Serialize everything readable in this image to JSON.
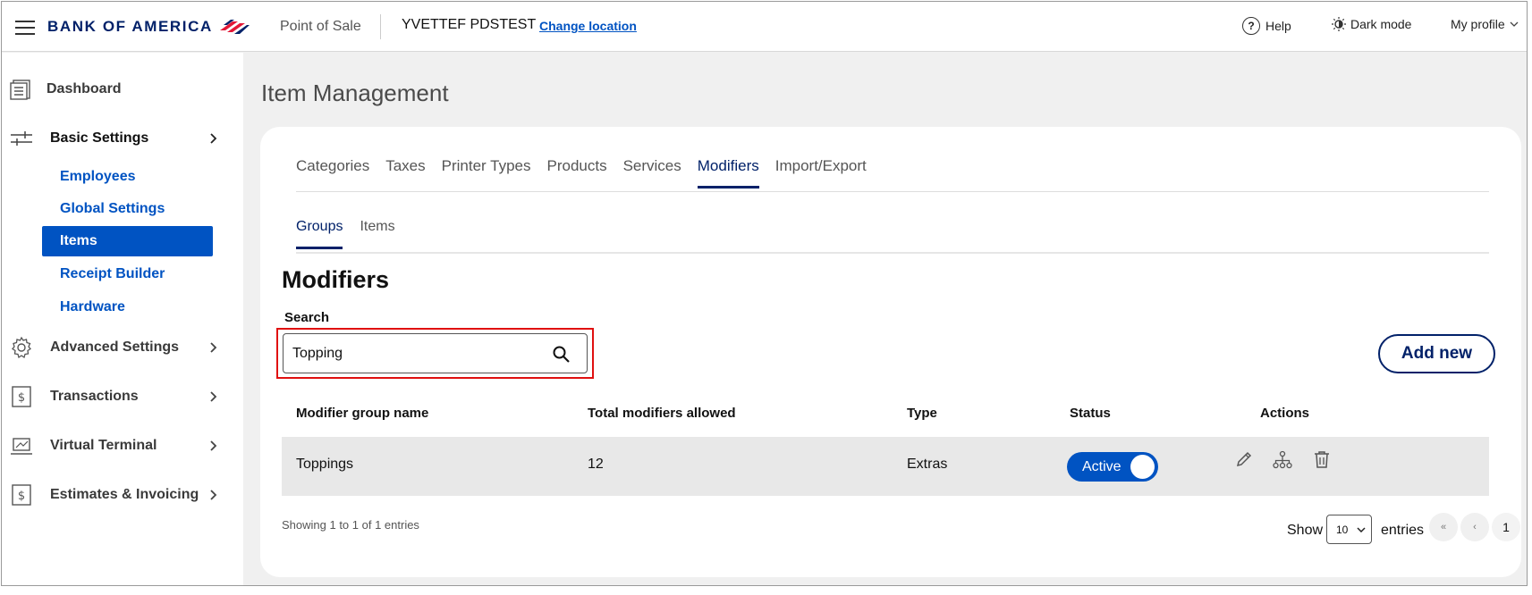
{
  "header": {
    "logo_text": "BANK OF AMERICA",
    "app_name": "Point of Sale",
    "store_name": "YVETTEF PDSTEST",
    "change_location": "Change location",
    "help": "Help",
    "dark_mode": "Dark mode",
    "profile": "My profile"
  },
  "sidebar": {
    "dashboard": "Dashboard",
    "basic_settings": "Basic Settings",
    "sub_items": [
      "Employees",
      "Global Settings",
      "Items",
      "Receipt Builder",
      "Hardware"
    ],
    "active_sub": "Items",
    "advanced_settings": "Advanced Settings",
    "transactions": "Transactions",
    "virtual_terminal": "Virtual Terminal",
    "estimates_invoicing": "Estimates & Invoicing"
  },
  "main": {
    "page_title": "Item Management",
    "tabs": [
      "Categories",
      "Taxes",
      "Printer Types",
      "Products",
      "Services",
      "Modifiers",
      "Import/Export"
    ],
    "active_tab": "Modifiers",
    "subtabs": [
      "Groups",
      "Items"
    ],
    "active_subtab": "Groups",
    "section_title": "Modifiers",
    "search": {
      "label": "Search",
      "value": "Topping"
    },
    "add_new": "Add new",
    "table": {
      "headers": [
        "Modifier group name",
        "Total modifiers allowed",
        "Type",
        "Status",
        "Actions"
      ],
      "rows": [
        {
          "name": "Toppings",
          "total": "12",
          "type": "Extras",
          "status": "Active"
        }
      ]
    },
    "footer": {
      "showing": "Showing 1 to 1 of 1 entries",
      "show": "Show",
      "page_size": "10",
      "entries": "entries",
      "pager": [
        "«",
        "‹",
        "1",
        "›",
        "»"
      ]
    }
  },
  "colors": {
    "brand_navy": "#012169",
    "brand_red": "#e31837",
    "accent_blue": "#0053c2",
    "highlight_red": "#e01010"
  }
}
